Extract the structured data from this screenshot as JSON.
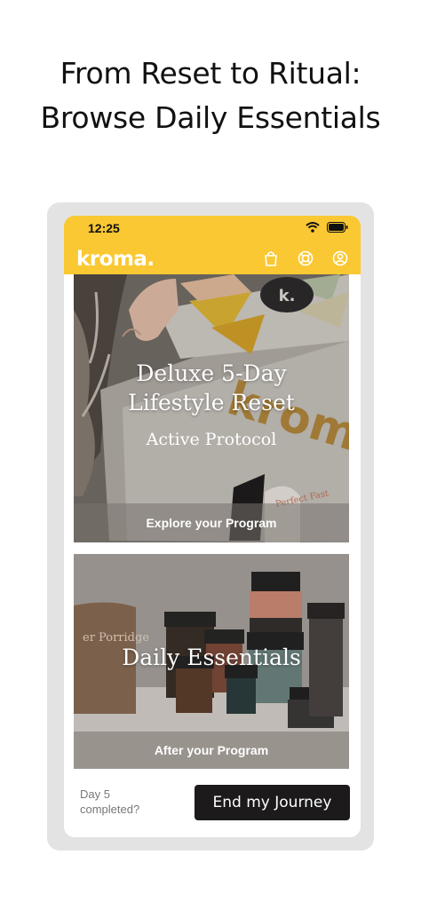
{
  "headline": {
    "line1": "From Reset to Ritual:",
    "line2": "Browse Daily Essentials"
  },
  "status_bar": {
    "time": "12:25",
    "icons": [
      "wifi-icon",
      "battery-icon"
    ]
  },
  "app_bar": {
    "logo": "kroma.",
    "icons": [
      "shopping-bag-icon",
      "support-lifebuoy-icon",
      "profile-icon"
    ],
    "color": "#fac832"
  },
  "program_card": {
    "title_line1": "Deluxe 5-Day",
    "title_line2": "Lifestyle Reset",
    "subtitle": "Active Protocol",
    "cta": "Explore your Program",
    "box_brand_text": "kroma.",
    "tile_lid_letter": "k.",
    "jar_label": "Perfect Fast"
  },
  "essentials_card": {
    "title": "Daily Essentials",
    "cta": "After your Program",
    "bag_label": "er Porridge"
  },
  "footer": {
    "day_line1": "Day 5",
    "day_line2": "completed?",
    "end_button": "End my Journey"
  }
}
